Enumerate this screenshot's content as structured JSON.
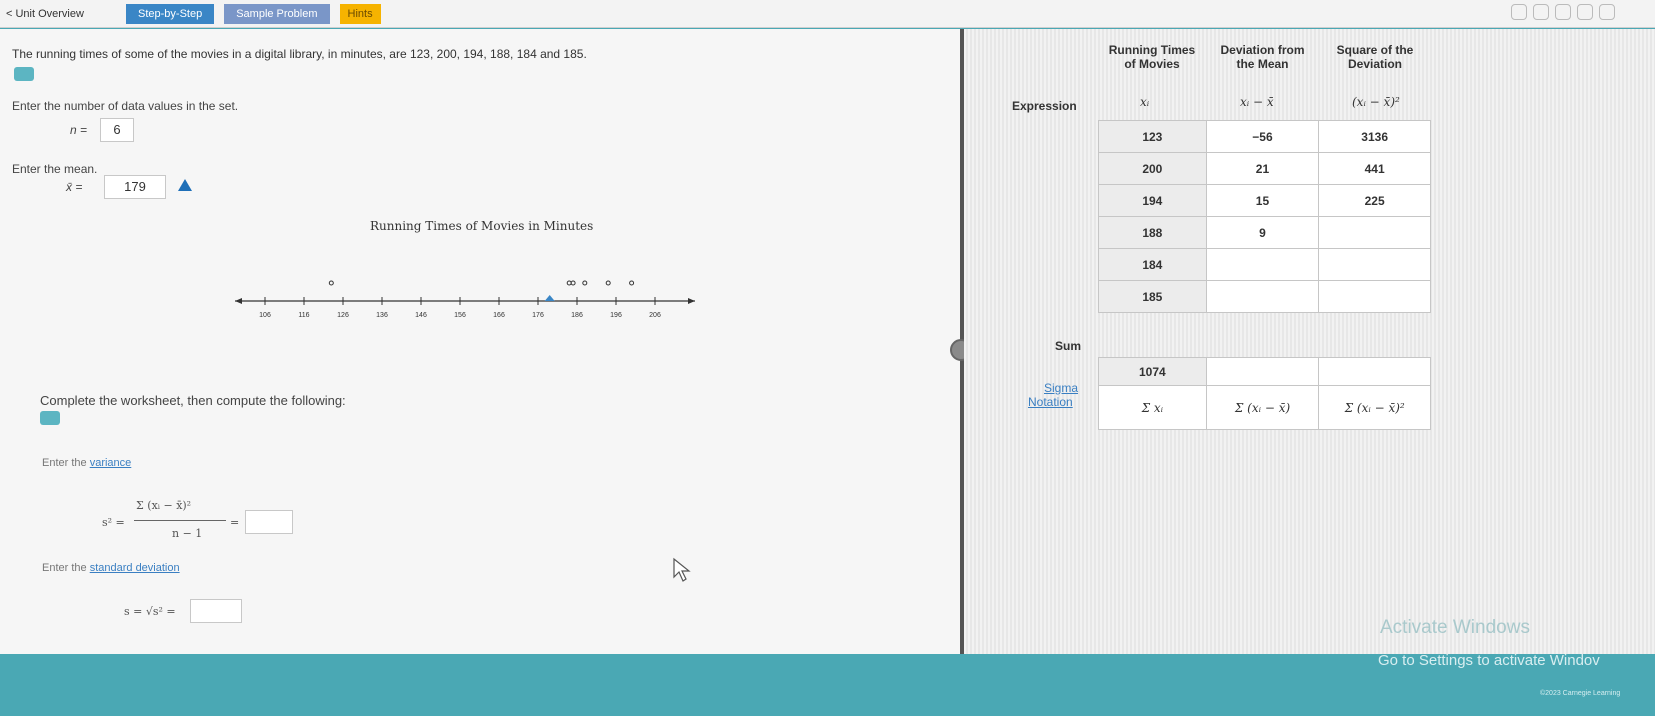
{
  "nav": {
    "back_label": "< Unit Overview",
    "tabs": [
      {
        "label": "Step-by-Step"
      },
      {
        "label": "Sample Problem"
      },
      {
        "label": "Hints"
      }
    ]
  },
  "problem": {
    "statement": "The running times of some of the movies in a digital library, in minutes, are 123, 200, 194, 188, 184 and 185.",
    "n_prompt": "Enter the number of data values in the set.",
    "n_label": "n =",
    "n_value": "6",
    "mean_prompt": "Enter the mean.",
    "mean_label": "x̄ =",
    "mean_value": "179"
  },
  "dotplot": {
    "title": "Running Times of Movies in Minutes",
    "ticks": [
      "106",
      "116",
      "126",
      "136",
      "146",
      "156",
      "166",
      "176",
      "186",
      "196",
      "206"
    ],
    "points": [
      123,
      184,
      185,
      188,
      194,
      200
    ],
    "mean_marker": 179
  },
  "worksheet": {
    "complete_prompt": "Complete the worksheet, then compute the following:",
    "variance_prompt_prefix": "Enter the ",
    "variance_link": "variance",
    "variance_formula_num": "Σ (xᵢ − x̄)²",
    "variance_formula_den": "n − 1",
    "variance_lhs": "s² =",
    "variance_value": "",
    "sd_prompt_prefix": "Enter the ",
    "sd_link": "standard deviation",
    "sd_lhs": "s = √s² =",
    "sd_value": ""
  },
  "table": {
    "headers": [
      {
        "line1": "Running Times",
        "line2": "of Movies"
      },
      {
        "line1": "Deviation from",
        "line2": "the Mean"
      },
      {
        "line1": "Square of the",
        "line2": "Deviation"
      }
    ],
    "expression_label": "Expression",
    "expressions": [
      "xᵢ",
      "xᵢ − x̄",
      "(xᵢ − x̄)²"
    ],
    "rows": [
      [
        "123",
        "−56",
        "3136"
      ],
      [
        "200",
        "21",
        "441"
      ],
      [
        "194",
        "15",
        "225"
      ],
      [
        "188",
        "9",
        ""
      ],
      [
        "184",
        "",
        ""
      ],
      [
        "185",
        "",
        ""
      ]
    ],
    "sum_label": "Sum",
    "sums": [
      "1074",
      "",
      ""
    ],
    "sigma_label_1": "Sigma",
    "sigma_label_2": "Notation",
    "sigma_notations": [
      "Σ xᵢ",
      "Σ (xᵢ − x̄)",
      "Σ (xᵢ − x̄)²"
    ]
  },
  "windows": {
    "activate_title": "Activate Windows",
    "activate_sub": "Go to Settings to activate Windov",
    "copyright": "©2023 Carnegie Learning"
  },
  "colors": {
    "accent_blue": "#3a86c6",
    "hints_yellow": "#f6b300",
    "teal": "#4aa8b4"
  }
}
